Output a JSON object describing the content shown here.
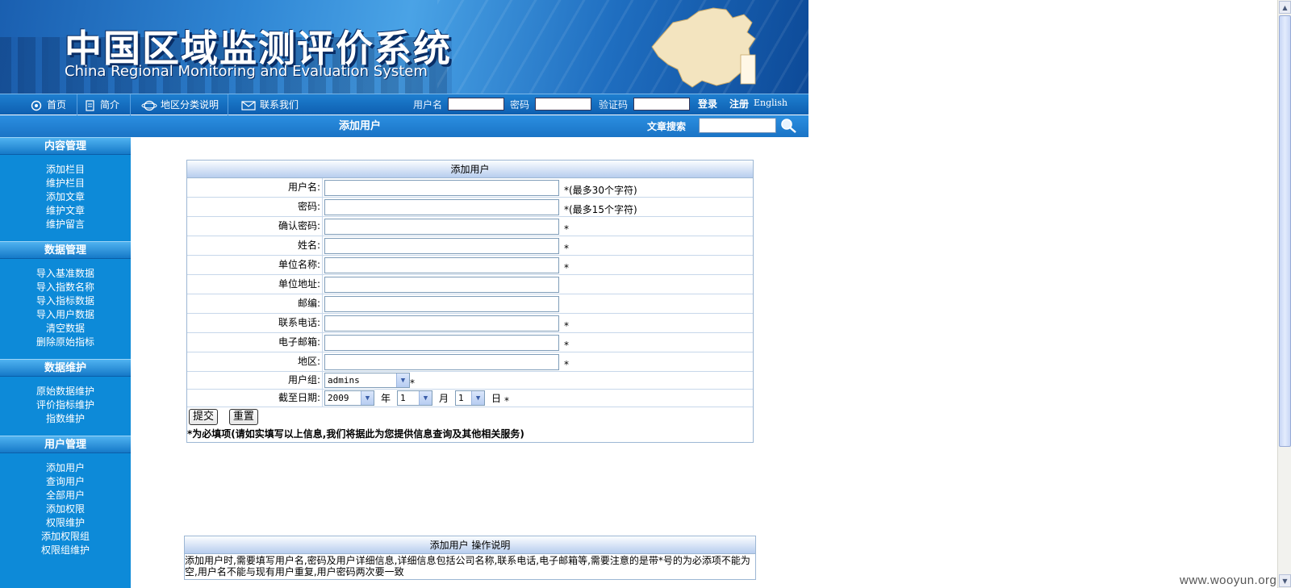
{
  "banner": {
    "title_cn": "中国区域监测评价系统",
    "title_en": "China Regional Monitoring and Evaluation System"
  },
  "topnav": {
    "items": [
      {
        "label": "首页",
        "icon": "home-icon"
      },
      {
        "label": "简介",
        "icon": "document-icon"
      },
      {
        "label": "地区分类说明",
        "icon": "globe-icon"
      },
      {
        "label": "联系我们",
        "icon": "envelope-icon"
      }
    ],
    "username_label": "用户名",
    "password_label": "密码",
    "captcha_label": "验证码",
    "login_label": "登录",
    "register_label": "注册",
    "english_label": "English"
  },
  "subheader": {
    "page_title": "添加用户",
    "search_label": "文章搜索"
  },
  "sidebar": {
    "groups": [
      {
        "title": "内容管理",
        "items": [
          "添加栏目",
          "维护栏目",
          "添加文章",
          "维护文章",
          "维护留言"
        ]
      },
      {
        "title": "数据管理",
        "items": [
          "导入基准数据",
          "导入指数名称",
          "导入指标数据",
          "导入用户数据",
          "清空数据",
          "删除原始指标"
        ]
      },
      {
        "title": "数据维护",
        "items": [
          "原始数据维护",
          "评价指标维护",
          "指数维护"
        ]
      },
      {
        "title": "用户管理",
        "items": [
          "添加用户",
          "查询用户",
          "全部用户",
          "添加权限",
          "权限维护",
          "添加权限组",
          "权限组维护"
        ]
      }
    ]
  },
  "form": {
    "title": "添加用户",
    "fields": [
      {
        "label": "用户名:",
        "required": "*",
        "hint": "(最多30个字符)"
      },
      {
        "label": "密码:",
        "required": "*",
        "hint": "(最多15个字符)"
      },
      {
        "label": "确认密码:",
        "required": "*",
        "hint": ""
      },
      {
        "label": "姓名:",
        "required": "*",
        "hint": ""
      },
      {
        "label": "单位名称:",
        "required": "*",
        "hint": ""
      },
      {
        "label": "单位地址:",
        "required": "",
        "hint": ""
      },
      {
        "label": "邮编:",
        "required": "",
        "hint": ""
      },
      {
        "label": "联系电话:",
        "required": "*",
        "hint": ""
      },
      {
        "label": "电子邮箱:",
        "required": "*",
        "hint": ""
      },
      {
        "label": "地区:",
        "required": "*",
        "hint": ""
      }
    ],
    "group_label": "用户组:",
    "group_value": "admins",
    "date_label": "截至日期:",
    "year_value": "2009",
    "year_unit": "年",
    "month_value": "1",
    "month_unit": "月",
    "day_value": "1",
    "day_unit": "日",
    "required_mark": "*",
    "submit_label": "提交",
    "reset_label": "重置",
    "note": "*为必填项(请如实填写以上信息,我们将据此为您提供信息查询及其他相关服务)"
  },
  "help": {
    "title": "添加用户 操作说明",
    "text": "添加用户时,需要填写用户名,密码及用户详细信息,详细信息包括公司名称,联系电话,电子邮箱等,需要注意的是带*号的为必添项不能为空,用户名不能与现有用户重复,用户密码两次要一致"
  },
  "watermark": "www.wooyun.org",
  "colors": {
    "banner_blue": "#1f6ec0",
    "sidebar_blue": "#0d8ad8",
    "panel_border": "#9db7d4"
  }
}
